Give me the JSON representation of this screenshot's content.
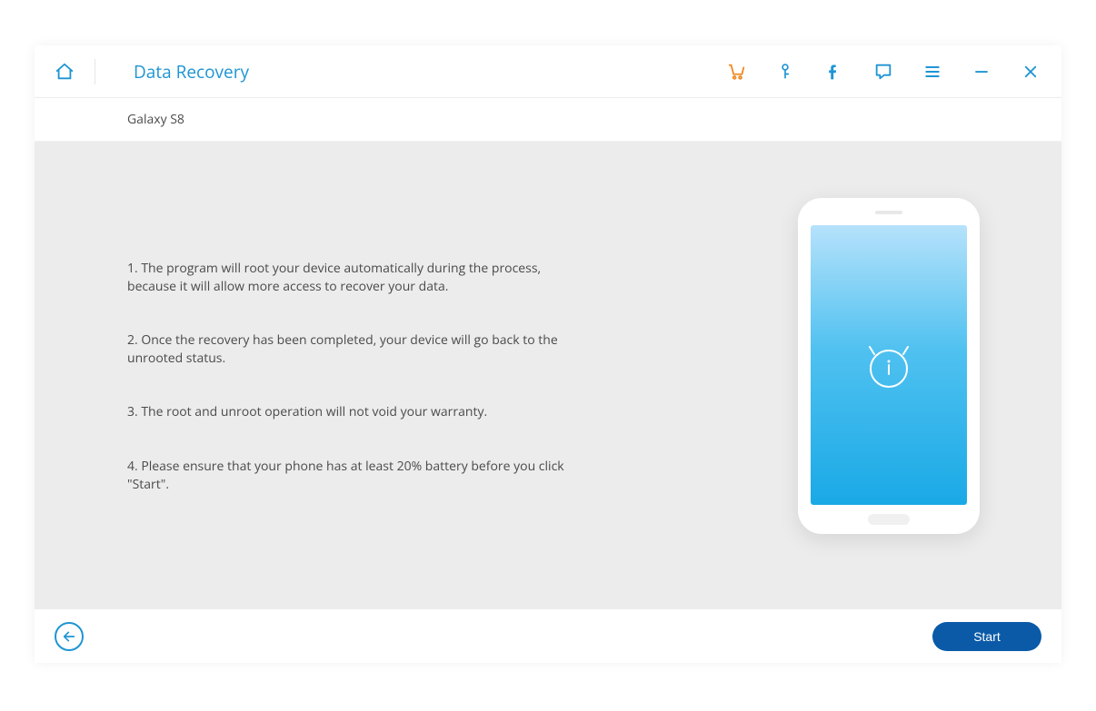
{
  "header": {
    "title": "Data Recovery"
  },
  "subheader": {
    "device_name": "Galaxy S8"
  },
  "info": {
    "item1": "1. The program will root your device automatically during the process, because it will allow more access to recover your data.",
    "item2": "2. Once the recovery has been completed, your device will go back to the unrooted status.",
    "item3": "3. The root and unroot operation will not void your warranty.",
    "item4": "4. Please ensure that your phone has at least 20% battery before you click \"Start\"."
  },
  "footer": {
    "start_label": "Start"
  },
  "colors": {
    "accent": "#1e95d4",
    "primary_button": "#0a5aa8",
    "cart_icon": "#f08a24"
  }
}
